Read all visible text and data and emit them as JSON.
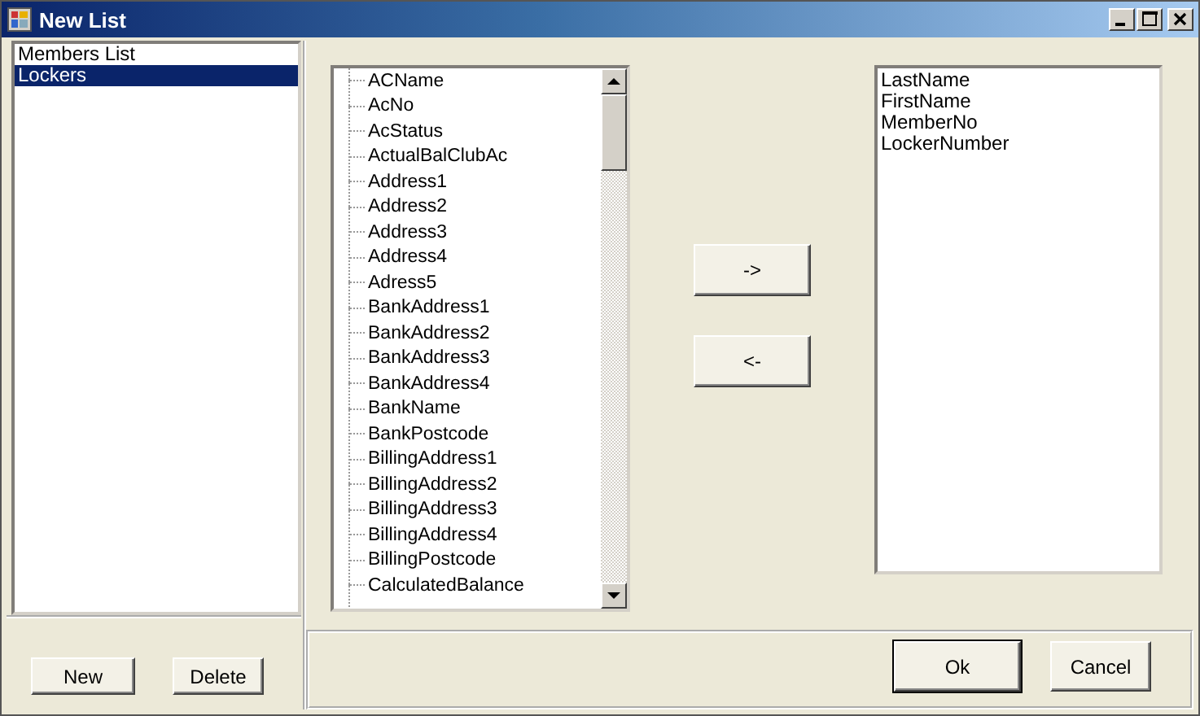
{
  "window": {
    "title": "New List",
    "controls": [
      {
        "kind": "minimize"
      },
      {
        "kind": "maximize"
      },
      {
        "kind": "close"
      }
    ]
  },
  "lists": {
    "items": [
      {
        "label": "Members List",
        "selected": false
      },
      {
        "label": "Lockers",
        "selected": true
      }
    ]
  },
  "list_buttons": [
    "New",
    "Delete"
  ],
  "fields_tree": {
    "items": [
      "ACName",
      "AcNo",
      "AcStatus",
      "ActualBalClubAc",
      "Address1",
      "Address2",
      "Address3",
      "Address4",
      "Adress5",
      "BankAddress1",
      "BankAddress2",
      "BankAddress3",
      "BankAddress4",
      "BankName",
      "BankPostcode",
      "BillingAddress1",
      "BillingAddress2",
      "BillingAddress3",
      "BillingAddress4",
      "BillingPostcode",
      "CalculatedBalance"
    ]
  },
  "move_buttons": [
    "->",
    "<-"
  ],
  "selected_fields": {
    "items": [
      "LastName",
      "FirstName",
      "MemberNo",
      "LockerNumber"
    ]
  },
  "dialog_buttons": [
    {
      "label": "Ok",
      "default": true
    },
    {
      "label": "Cancel",
      "default": false
    }
  ]
}
